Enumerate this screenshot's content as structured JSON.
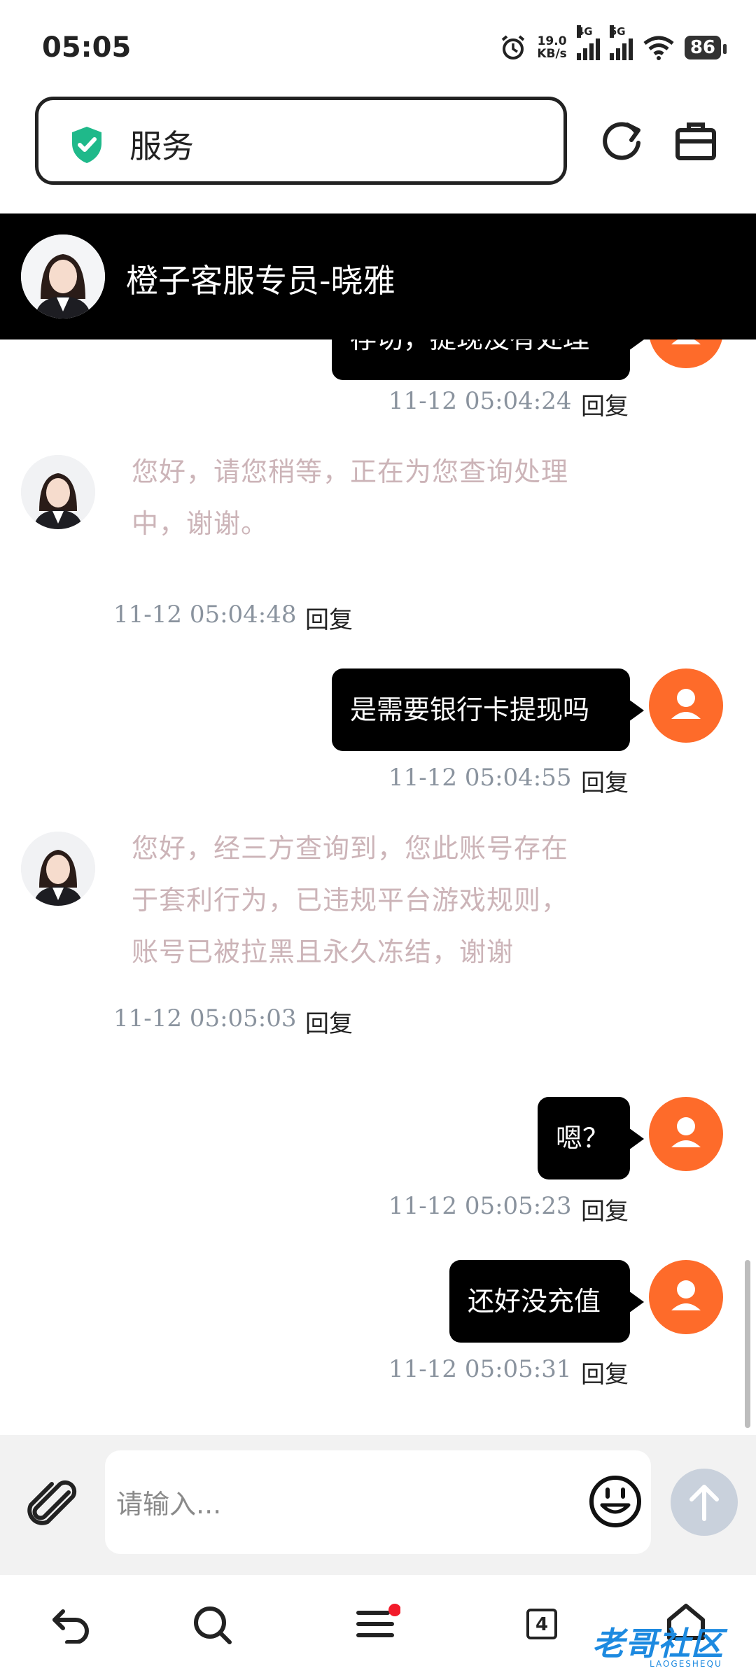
{
  "status": {
    "time": "05:05",
    "net_speed": "19.0",
    "net_unit": "KB/s",
    "sig1_tag": "4G",
    "sig2_tag": "5G",
    "battery": "86"
  },
  "url_bar": {
    "text": "服务"
  },
  "chat": {
    "title": "橙子客服专员-晓雅",
    "reply_label": "回复",
    "partial_text": "存切，提现没有处理",
    "messages": [
      {
        "sender": "user",
        "text": "",
        "time": "11-12 05:04:24"
      },
      {
        "sender": "agent",
        "lines": [
          "您好，请您稍等，正在为您查询处理",
          "中，谢谢。"
        ],
        "time": "11-12 05:04:48"
      },
      {
        "sender": "user",
        "text": "是需要银行卡提现吗",
        "time": "11-12 05:04:55"
      },
      {
        "sender": "agent",
        "lines": [
          "您好，经三方查询到，您此账号存在",
          "于套利行为，已违规平台游戏规则，",
          "账号已被拉黑且永久冻结，谢谢"
        ],
        "time": "11-12 05:05:03"
      },
      {
        "sender": "user",
        "text": "嗯？",
        "time": "11-12 05:05:23"
      },
      {
        "sender": "user",
        "text": "还好没充值",
        "time": "11-12 05:05:31"
      }
    ]
  },
  "input": {
    "placeholder": "请输入..."
  },
  "nav": {
    "tab_count": "4"
  },
  "watermark": {
    "text": "老哥社区",
    "sub": "LAOGESHEQU"
  },
  "colors": {
    "user_avatar": "#fe6b2a",
    "agent_text": "#ccb4b8",
    "timestamp": "#8a939e",
    "bubble": "#000000",
    "send_button": "#c9d1dc"
  }
}
